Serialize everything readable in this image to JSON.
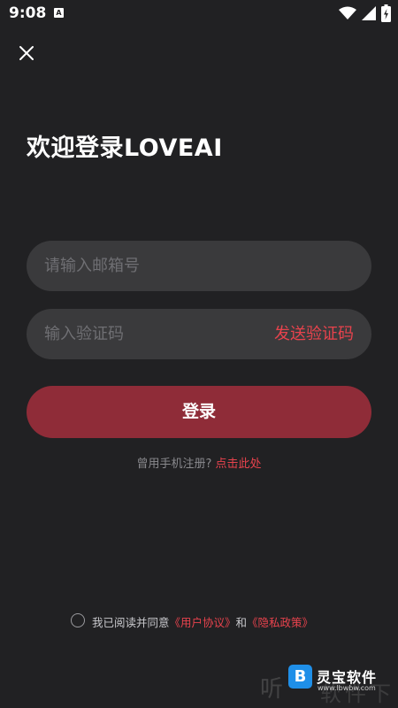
{
  "status_bar": {
    "time": "9:08",
    "notification_icon": "A",
    "icons": [
      "wifi-icon",
      "signal-icon",
      "battery-charging-icon"
    ]
  },
  "header": {
    "close_icon": "close-icon",
    "title": "欢迎登录LOVEAI"
  },
  "form": {
    "email_placeholder": "请输入邮箱号",
    "email_value": "",
    "code_placeholder": "输入验证码",
    "code_value": "",
    "send_code_label": "发送验证码",
    "login_label": "登录"
  },
  "register": {
    "prompt": "曾用手机注册?",
    "link": "点击此处"
  },
  "agreement": {
    "checked": false,
    "prefix": "我已阅读并同意",
    "user_agreement": "《用户协议》",
    "conjunction": "和",
    "privacy_policy": "《隐私政策》"
  },
  "watermark": {
    "char": "听",
    "logo": "B",
    "brand": "灵宝软件",
    "url": "www.lbwbw.com",
    "bg_text": "软件下载"
  },
  "colors": {
    "background": "#212123",
    "field": "#3a3a3c",
    "accent": "#e8434d",
    "button": "#8f2c38"
  }
}
